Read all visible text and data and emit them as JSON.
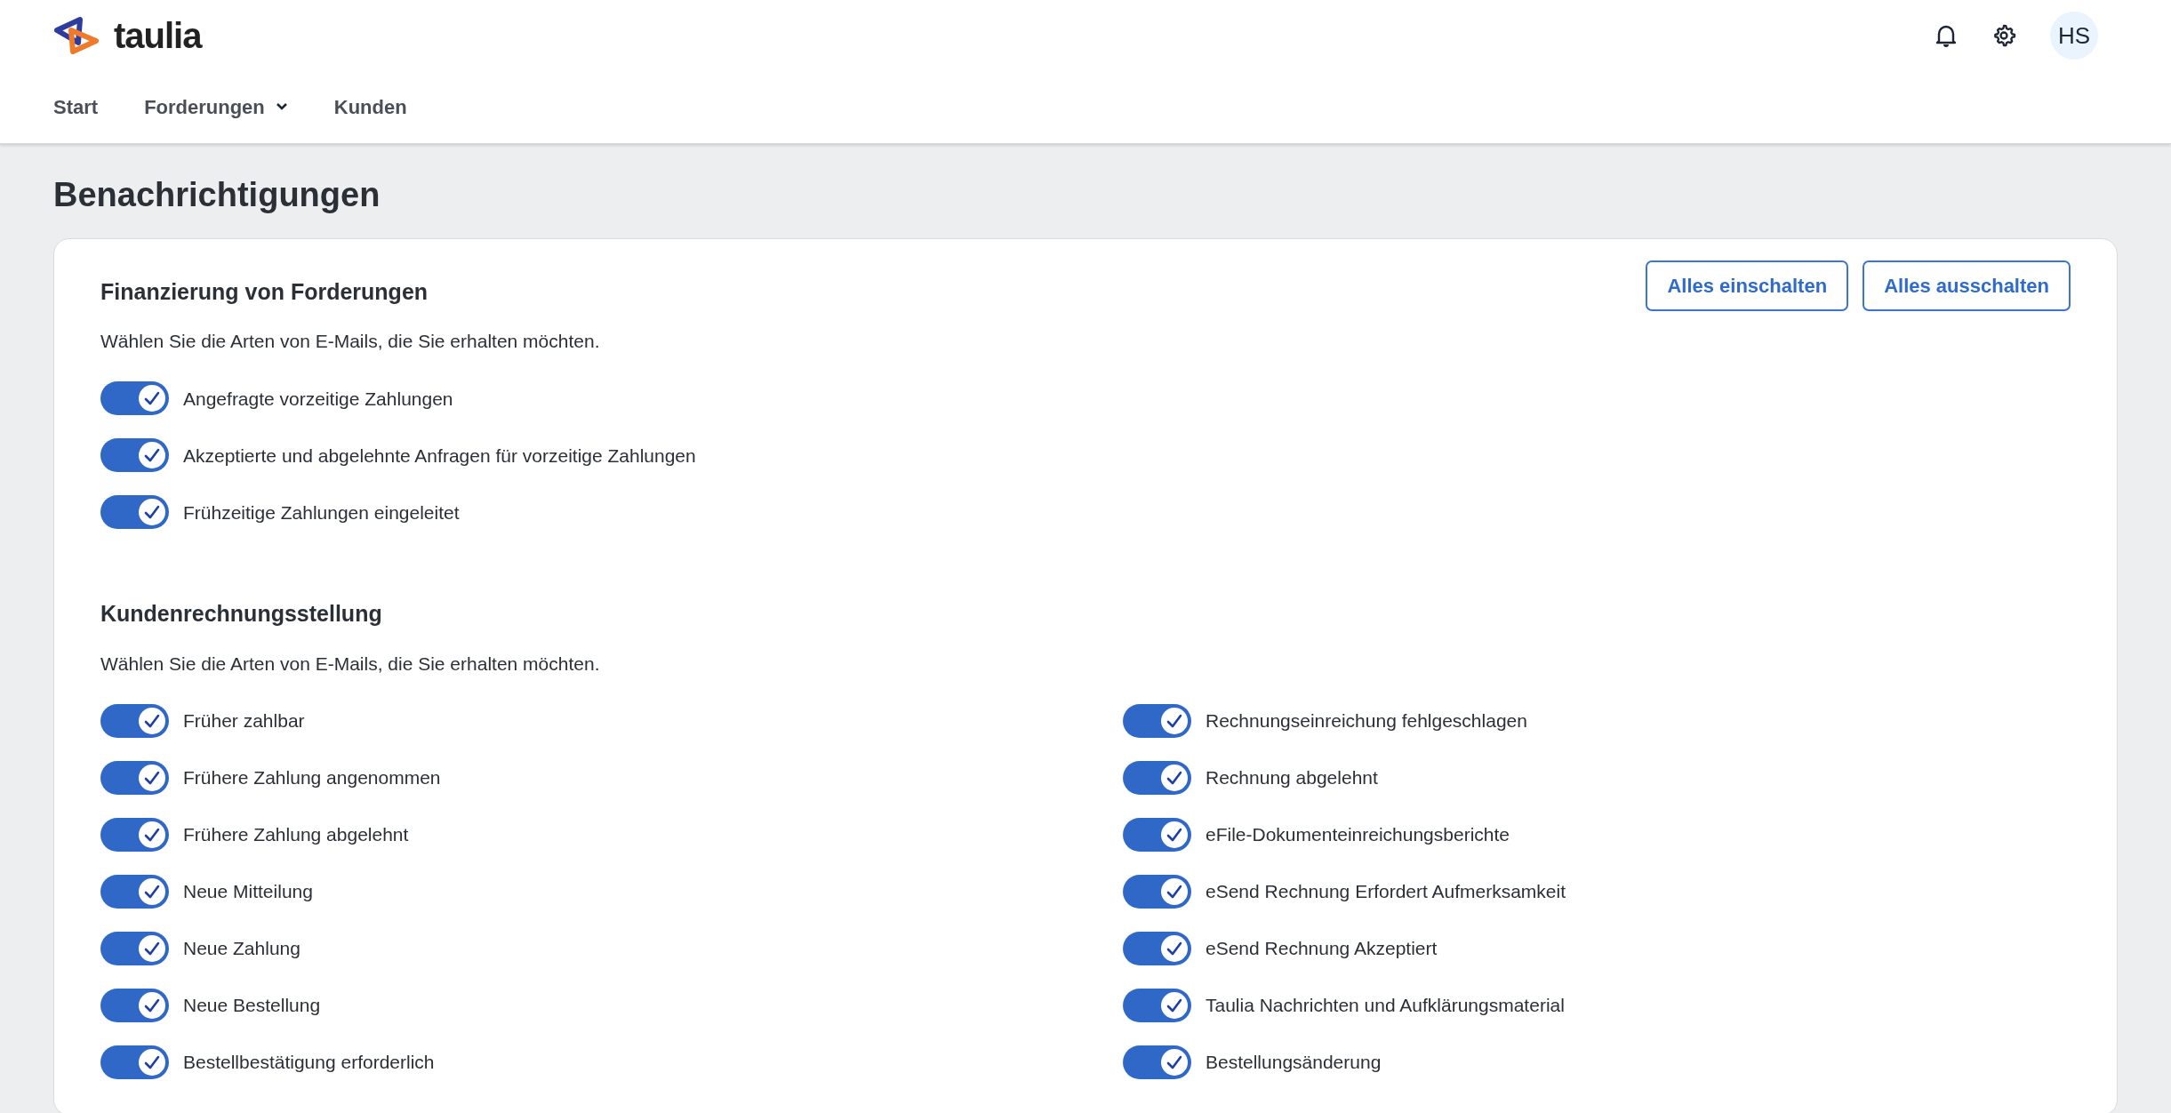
{
  "header": {
    "logo": "taulia",
    "nav": [
      {
        "label": "Start",
        "dropdown": false
      },
      {
        "label": "Forderungen",
        "dropdown": true
      },
      {
        "label": "Kunden",
        "dropdown": false
      }
    ],
    "avatar": "HS"
  },
  "page_title": "Benachrichtigungen",
  "buttons": [
    "Alles einschalten",
    "Alles ausschalten"
  ],
  "sections": [
    {
      "title": "Finanzierung von Forderungen",
      "description": "Wählen Sie die Arten von E-Mails, die Sie erhalten möchten.",
      "columns": [
        [
          {
            "label": "Angefragte vorzeitige Zahlungen",
            "on": true
          },
          {
            "label": "Akzeptierte und abgelehnte Anfragen für vorzeitige Zahlungen",
            "on": true
          },
          {
            "label": "Frühzeitige Zahlungen eingeleitet",
            "on": true
          }
        ]
      ]
    },
    {
      "title": "Kundenrechnungsstellung",
      "description": "Wählen Sie die Arten von E-Mails, die Sie erhalten möchten.",
      "columns": [
        [
          {
            "label": "Früher zahlbar",
            "on": true
          },
          {
            "label": "Frühere Zahlung angenommen",
            "on": true
          },
          {
            "label": "Frühere Zahlung abgelehnt",
            "on": true
          },
          {
            "label": "Neue Mitteilung",
            "on": true
          },
          {
            "label": "Neue Zahlung",
            "on": true
          },
          {
            "label": "Neue Bestellung",
            "on": true
          },
          {
            "label": "Bestellbestätigung erforderlich",
            "on": true
          }
        ],
        [
          {
            "label": "Rechnungseinreichung fehlgeschlagen",
            "on": true
          },
          {
            "label": "Rechnung abgelehnt",
            "on": true
          },
          {
            "label": "eFile-Dokumenteinreichungsberichte",
            "on": true
          },
          {
            "label": "eSend Rechnung Erfordert Aufmerksamkeit",
            "on": true
          },
          {
            "label": "eSend Rechnung Akzeptiert",
            "on": true
          },
          {
            "label": "Taulia Nachrichten und Aufklärungsmaterial",
            "on": true
          },
          {
            "label": "Bestellungsänderung",
            "on": true
          }
        ]
      ]
    }
  ]
}
